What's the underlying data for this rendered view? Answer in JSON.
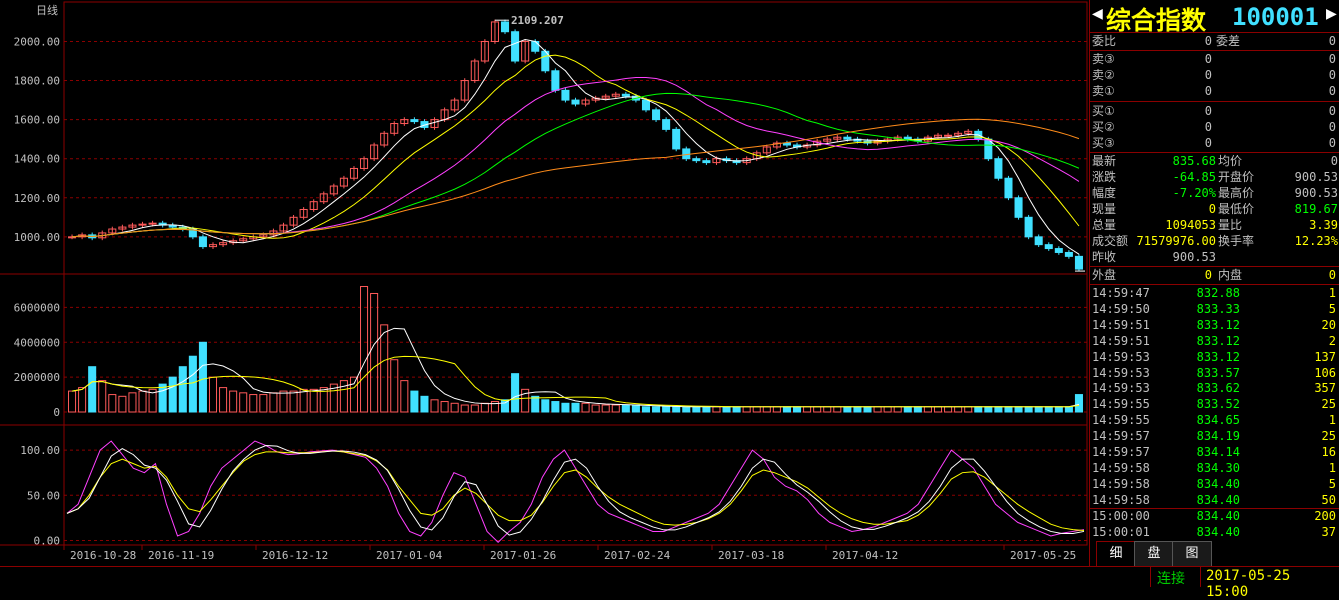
{
  "chart": {
    "period_label": "日线",
    "peak_label": "2109.207",
    "low_label": "819.6719",
    "price_ticks": [
      "2000.00",
      "1800.00",
      "1600.00",
      "1400.00",
      "1200.00",
      "1000.00"
    ],
    "volume_ticks": [
      "6000000",
      "4000000",
      "2000000",
      "0"
    ],
    "kdj_ticks": [
      "100.00",
      "50.00",
      "0.00"
    ],
    "date_ticks": [
      "2016-10-28",
      "2016-11-19",
      "2016-12-12",
      "2017-01-04",
      "2017-01-26",
      "2017-02-24",
      "2017-03-18",
      "2017-04-12",
      "2017-05-25"
    ],
    "colors": {
      "up": "#ff5a5a",
      "down": "#40e0ff",
      "ma5": "#ffffff",
      "ma10": "#ffff00",
      "ma20": "#ff40ff",
      "ma30": "#00ff00",
      "ma60": "#ff8c1a",
      "grid": "#8b0000"
    }
  },
  "chart_data": {
    "type": "line",
    "price_axis": {
      "ylim": [
        820,
        2110
      ]
    },
    "volume_axis": {
      "ylim": [
        0,
        7000000
      ]
    },
    "kdj_axis": {
      "ylim": [
        -5,
        120
      ]
    },
    "close_series": [
      1000,
      1010,
      995,
      1020,
      1040,
      1050,
      1060,
      1065,
      1070,
      1060,
      1050,
      1040,
      1000,
      950,
      960,
      970,
      980,
      990,
      1000,
      1010,
      1030,
      1060,
      1100,
      1140,
      1180,
      1220,
      1260,
      1300,
      1350,
      1400,
      1470,
      1530,
      1580,
      1600,
      1590,
      1560,
      1600,
      1650,
      1700,
      1800,
      1900,
      2000,
      2100,
      2050,
      1900,
      2000,
      1950,
      1850,
      1750,
      1700,
      1680,
      1700,
      1710,
      1720,
      1730,
      1720,
      1700,
      1650,
      1600,
      1550,
      1450,
      1400,
      1390,
      1380,
      1400,
      1390,
      1380,
      1400,
      1430,
      1460,
      1480,
      1470,
      1460,
      1470,
      1490,
      1500,
      1510,
      1500,
      1490,
      1480,
      1490,
      1500,
      1510,
      1500,
      1490,
      1510,
      1520,
      1520,
      1530,
      1540,
      1500,
      1400,
      1300,
      1200,
      1100,
      1000,
      960,
      940,
      920,
      900,
      835
    ],
    "volume_series": [
      1200000,
      1400000,
      2600000,
      1800000,
      1000000,
      900000,
      1100000,
      1200000,
      1300000,
      1600000,
      2000000,
      2600000,
      3200000,
      4000000,
      2000000,
      1400000,
      1200000,
      1100000,
      1000000,
      1000000,
      1100000,
      1200000,
      1200000,
      1300000,
      1300000,
      1400000,
      1600000,
      1800000,
      2000000,
      7200000,
      6800000,
      5000000,
      3000000,
      1800000,
      1200000,
      900000,
      700000,
      600000,
      500000,
      400000,
      400000,
      500000,
      600000,
      700000,
      2200000,
      1300000,
      900000,
      700000,
      600000,
      500000,
      500000,
      500000,
      400000,
      400000,
      400000,
      400000,
      400000,
      300000,
      300000,
      300000,
      300000,
      300000,
      300000,
      300000,
      300000,
      300000,
      300000,
      300000,
      300000,
      300000,
      300000,
      300000,
      300000,
      300000,
      300000,
      300000,
      300000,
      300000,
      300000,
      300000,
      300000,
      300000,
      300000,
      300000,
      300000,
      300000,
      300000,
      300000,
      300000,
      300000,
      300000,
      300000,
      300000,
      300000,
      300000,
      300000,
      300000,
      300000,
      300000,
      300000,
      1000000
    ],
    "kdj_k": [
      30,
      40,
      70,
      100,
      110,
      95,
      80,
      75,
      85,
      40,
      5,
      10,
      30,
      60,
      80,
      90,
      100,
      110,
      105,
      98,
      95,
      96,
      98,
      99,
      100,
      98,
      95,
      92,
      80,
      60,
      30,
      10,
      5,
      20,
      50,
      75,
      70,
      40,
      10,
      -2,
      10,
      20,
      40,
      70,
      90,
      100,
      80,
      60,
      40,
      30,
      25,
      20,
      15,
      10,
      10,
      15,
      20,
      25,
      30,
      40,
      60,
      80,
      100,
      90,
      70,
      60,
      55,
      45,
      30,
      20,
      15,
      10,
      12,
      15,
      20,
      25,
      30,
      40,
      60,
      80,
      100,
      90,
      80,
      60,
      40,
      30,
      20,
      15,
      10,
      5,
      8,
      10,
      12
    ],
    "kdj_d": [
      30,
      35,
      50,
      70,
      85,
      90,
      85,
      80,
      82,
      70,
      50,
      35,
      32,
      45,
      60,
      75,
      88,
      95,
      98,
      98,
      97,
      97,
      97,
      98,
      99,
      98,
      96,
      94,
      88,
      78,
      60,
      45,
      30,
      28,
      35,
      50,
      58,
      52,
      40,
      28,
      22,
      22,
      28,
      42,
      60,
      75,
      78,
      70,
      58,
      48,
      40,
      34,
      28,
      22,
      18,
      17,
      18,
      20,
      24,
      30,
      40,
      55,
      72,
      78,
      75,
      70,
      65,
      58,
      48,
      38,
      30,
      24,
      20,
      18,
      18,
      20,
      22,
      28,
      38,
      52,
      68,
      75,
      76,
      70,
      60,
      50,
      40,
      32,
      25,
      18,
      14,
      12,
      11
    ]
  },
  "panel": {
    "title_name": "综合指数",
    "title_code": "100001",
    "order_rows": [
      {
        "l1": "委比",
        "v1": "0",
        "l2": "委差",
        "v2": "0"
      }
    ],
    "sell_rows": [
      {
        "label": "卖③",
        "price": "0",
        "vol": "0"
      },
      {
        "label": "卖②",
        "price": "0",
        "vol": "0"
      },
      {
        "label": "卖①",
        "price": "0",
        "vol": "0"
      }
    ],
    "buy_rows": [
      {
        "label": "买①",
        "price": "0",
        "vol": "0"
      },
      {
        "label": "买②",
        "price": "0",
        "vol": "0"
      },
      {
        "label": "买③",
        "price": "0",
        "vol": "0"
      }
    ],
    "quote_rows": [
      {
        "l1": "最新",
        "v1": "835.68",
        "c1": "#00ff00",
        "l2": "均价",
        "v2": "0",
        "c2": "#c0c0c0"
      },
      {
        "l1": "涨跌",
        "v1": "-64.85",
        "c1": "#00ff00",
        "l2": "开盘价",
        "v2": "900.53",
        "c2": "#c0c0c0"
      },
      {
        "l1": "幅度",
        "v1": "-7.20%",
        "c1": "#00ff00",
        "l2": "最高价",
        "v2": "900.53",
        "c2": "#c0c0c0"
      },
      {
        "l1": "现量",
        "v1": "0",
        "c1": "#ffff00",
        "l2": "最低价",
        "v2": "819.67",
        "c2": "#00ff00"
      },
      {
        "l1": "总量",
        "v1": "1094053",
        "c1": "#ffff00",
        "l2": "量比",
        "v2": "3.39",
        "c2": "#ffff00"
      },
      {
        "l1": "成交额",
        "v1": "71579976.00",
        "c1": "#ffff00",
        "l2": "换手率",
        "v2": "12.23%",
        "c2": "#ffff00"
      },
      {
        "l1": "昨收",
        "v1": "900.53",
        "c1": "#c0c0c0",
        "l2": "",
        "v2": "",
        "c2": "#c0c0c0"
      }
    ],
    "outer_row": {
      "label": "外盘",
      "value": "0",
      "label2": "内盘",
      "value2": "0"
    },
    "ticks": [
      {
        "time": "14:59:47",
        "price": "832.88",
        "vol": "1"
      },
      {
        "time": "14:59:50",
        "price": "833.33",
        "vol": "5"
      },
      {
        "time": "14:59:51",
        "price": "833.12",
        "vol": "20"
      },
      {
        "time": "14:59:51",
        "price": "833.12",
        "vol": "2"
      },
      {
        "time": "14:59:53",
        "price": "833.12",
        "vol": "137"
      },
      {
        "time": "14:59:53",
        "price": "833.57",
        "vol": "106"
      },
      {
        "time": "14:59:53",
        "price": "833.62",
        "vol": "357"
      },
      {
        "time": "14:59:55",
        "price": "833.52",
        "vol": "25"
      },
      {
        "time": "14:59:55",
        "price": "834.65",
        "vol": "1"
      },
      {
        "time": "14:59:57",
        "price": "834.19",
        "vol": "25"
      },
      {
        "time": "14:59:57",
        "price": "834.14",
        "vol": "16"
      },
      {
        "time": "14:59:58",
        "price": "834.30",
        "vol": "1"
      },
      {
        "time": "14:59:58",
        "price": "834.40",
        "vol": "5"
      },
      {
        "time": "14:59:58",
        "price": "834.40",
        "vol": "50"
      },
      {
        "time": "15:00:00",
        "price": "834.40",
        "vol": "200"
      },
      {
        "time": "15:00:01",
        "price": "834.40",
        "vol": "37"
      }
    ],
    "tabs": [
      "细",
      "盘",
      "图"
    ]
  },
  "status": {
    "connection": "连接",
    "datetime": "2017-05-25 15:00"
  }
}
